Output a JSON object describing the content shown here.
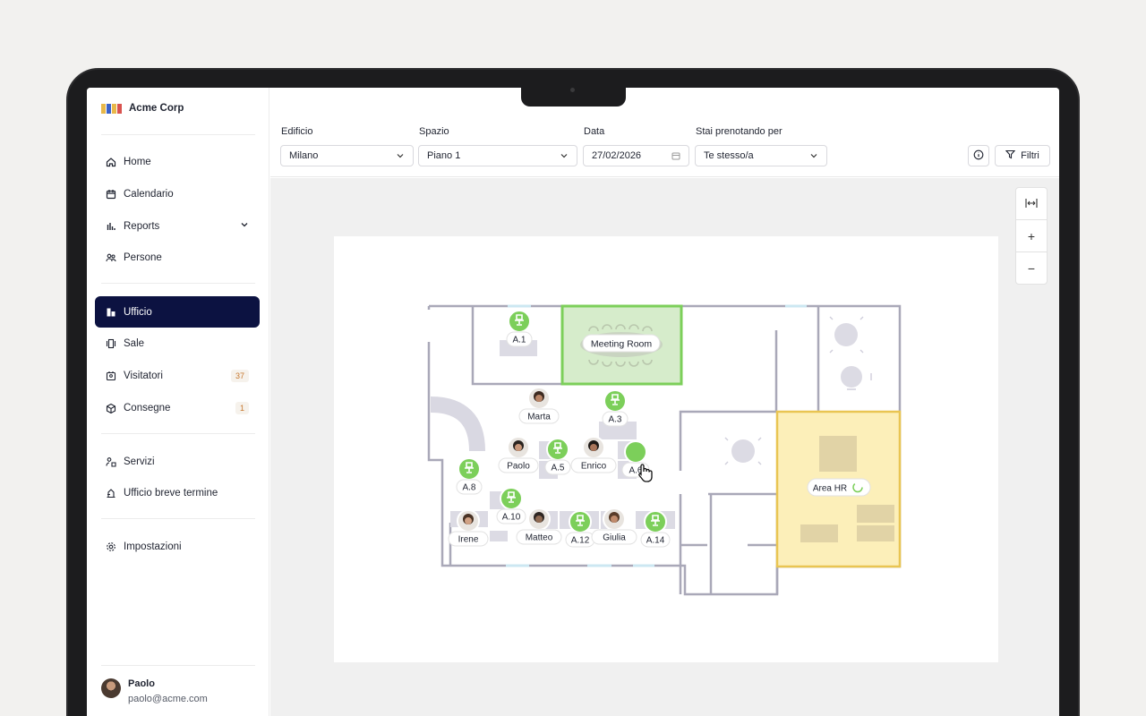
{
  "brand": {
    "name": "Acme Corp",
    "colors": [
      "#e8b84a",
      "#3b62c9",
      "#e8b84a",
      "#d9534f"
    ]
  },
  "sidebar": {
    "groups": [
      [
        {
          "label": "Home",
          "icon": "home-icon"
        },
        {
          "label": "Calendario",
          "icon": "calendar-icon"
        },
        {
          "label": "Reports",
          "icon": "bar-chart-icon",
          "expandable": true
        },
        {
          "label": "Persone",
          "icon": "people-icon"
        }
      ],
      [
        {
          "label": "Ufficio",
          "icon": "office-icon",
          "active": true
        },
        {
          "label": "Sale",
          "icon": "room-icon"
        },
        {
          "label": "Visitatori",
          "icon": "visitor-icon",
          "badge": "37"
        },
        {
          "label": "Consegne",
          "icon": "package-icon",
          "badge": "1"
        }
      ],
      [
        {
          "label": "Servizi",
          "icon": "services-icon"
        },
        {
          "label": "Ufficio breve termine",
          "icon": "short-term-icon"
        }
      ],
      [
        {
          "label": "Impostazioni",
          "icon": "gear-icon"
        }
      ]
    ],
    "user": {
      "name": "Paolo",
      "email": "paolo@acme.com"
    }
  },
  "filters": {
    "building": {
      "label": "Edificio",
      "value": "Milano"
    },
    "space": {
      "label": "Spazio",
      "value": "Piano 1"
    },
    "date": {
      "label": "Data",
      "value": "27/02/2026"
    },
    "booking_for": {
      "label": "Stai prenotando per",
      "value": "Te stesso/a"
    },
    "filters_button": "Filtri"
  },
  "zoom": {
    "fit": "fit-icon",
    "in": "+",
    "out": "−"
  },
  "floorplan": {
    "meeting_room": "Meeting Room",
    "area_hr": "Area HR",
    "available_desks": [
      "A.1",
      "A.3",
      "A.5",
      "A.8",
      "A.10",
      "A.12",
      "A.14"
    ],
    "occupied_desks": [
      "Marta",
      "Paolo",
      "Enrico",
      "Irene",
      "Matteo",
      "Giulia"
    ],
    "hover_desk": "A.6",
    "colors": {
      "available": "#7ccf5a",
      "meeting": "#d6eccb",
      "hr": "#fcefb9",
      "wall": "#a9a8b8"
    }
  }
}
